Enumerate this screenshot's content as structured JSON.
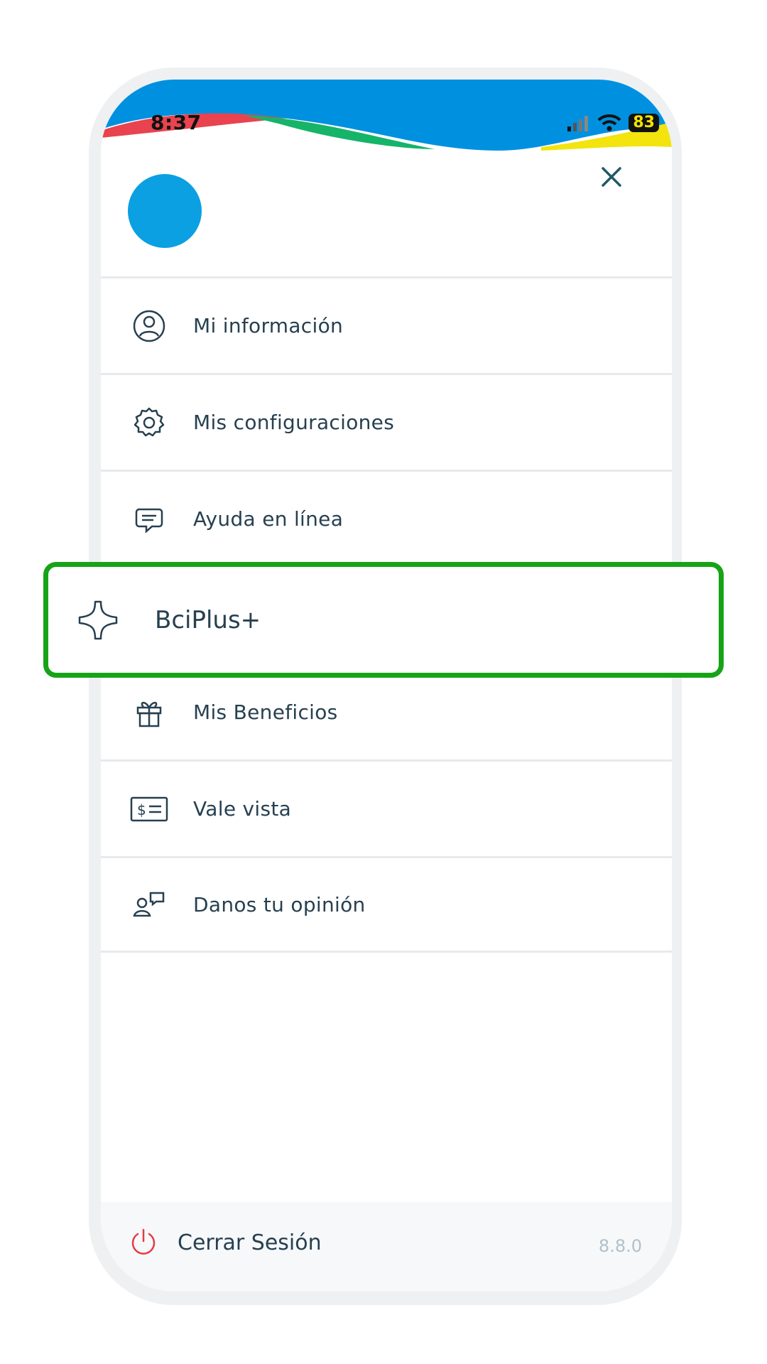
{
  "status_bar": {
    "time": "8:37",
    "battery": "83"
  },
  "header": {
    "close_icon": "close-icon"
  },
  "menu": {
    "items": [
      {
        "label": "Mi información",
        "icon": "user-circle-icon"
      },
      {
        "label": "Mis configuraciones",
        "icon": "gear-icon"
      },
      {
        "label": "Ayuda en línea",
        "icon": "chat-icon"
      },
      {
        "label": "",
        "icon": ""
      },
      {
        "label": "Mis Beneficios",
        "icon": "gift-icon"
      },
      {
        "label": "Vale vista",
        "icon": "dollar-list-icon"
      },
      {
        "label": "Danos tu opinión",
        "icon": "feedback-icon"
      }
    ]
  },
  "highlighted_item": {
    "label": "BciPlus+",
    "icon": "bciplus-star-icon",
    "border_color": "#17a317"
  },
  "footer": {
    "logout_label": "Cerrar Sesión",
    "version": "8.8.0"
  },
  "colors": {
    "header_blue": "#0090e0",
    "accent_text": "#274050",
    "power_red": "#e53b45"
  }
}
